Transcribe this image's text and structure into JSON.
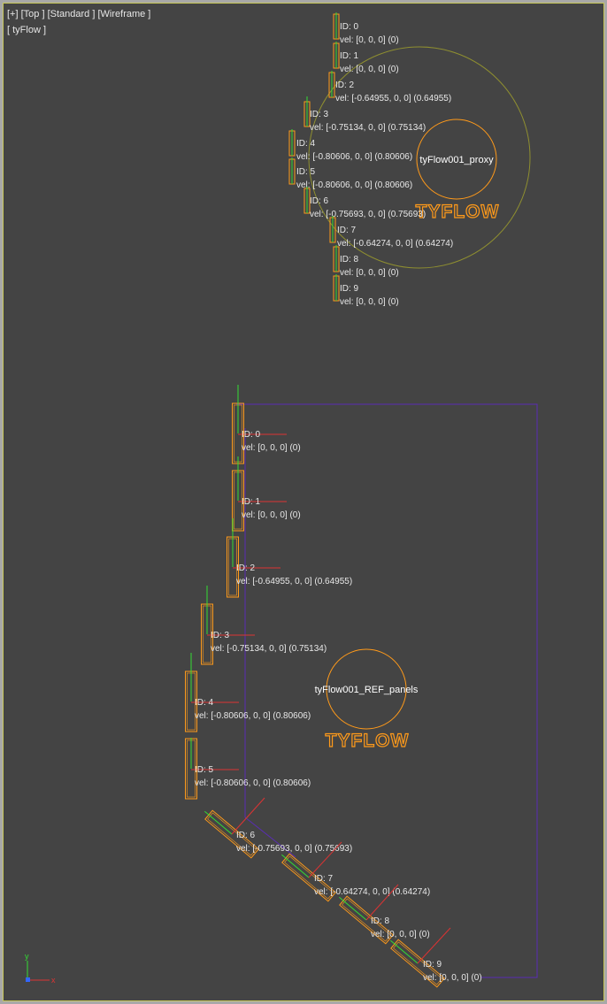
{
  "viewport": {
    "menu_plus": "[+]",
    "menu_view": "[Top ]",
    "menu_shading": "[Standard ]",
    "menu_display": "[Wireframe ]",
    "object_label": "[ tyFlow ]",
    "colors": {
      "background": "#444444",
      "border": "#c8c85a",
      "particle": "#ff9a1a",
      "y_axis": "#33dd33",
      "x_axis": "#dd3333",
      "bbox": "#5a2db5",
      "ring": "#9b9b35"
    }
  },
  "top_group": {
    "particles": [
      {
        "id": "ID: 0",
        "vel": "vel: [0, 0, 0] (0)"
      },
      {
        "id": "ID: 1",
        "vel": "vel: [0, 0, 0] (0)"
      },
      {
        "id": "ID: 2",
        "vel": "vel: [-0.64955, 0, 0] (0.64955)"
      },
      {
        "id": "ID: 3",
        "vel": "vel: [-0.75134, 0, 0] (0.75134)"
      },
      {
        "id": "ID: 4",
        "vel": "vel: [-0.80606, 0, 0] (0.80606)"
      },
      {
        "id": "ID: 5",
        "vel": "vel: [-0.80606, 0, 0] (0.80606)"
      },
      {
        "id": "ID: 6",
        "vel": "vel: [-0.75693, 0, 0] (0.75693)"
      },
      {
        "id": "ID: 7",
        "vel": "vel: [-0.64274, 0, 0] (0.64274)"
      },
      {
        "id": "ID: 8",
        "vel": "vel: [0, 0, 0] (0)"
      },
      {
        "id": "ID: 9",
        "vel": "vel: [0, 0, 0] (0)"
      }
    ],
    "proxy_name": "tyFlow001_proxy",
    "logo": "TYFLOW"
  },
  "bottom_group": {
    "particles": [
      {
        "id": "ID: 0",
        "vel": "vel: [0, 0, 0] (0)"
      },
      {
        "id": "ID: 1",
        "vel": "vel: [0, 0, 0] (0)"
      },
      {
        "id": "ID: 2",
        "vel": "vel: [-0.64955, 0, 0] (0.64955)"
      },
      {
        "id": "ID: 3",
        "vel": "vel: [-0.75134, 0, 0] (0.75134)"
      },
      {
        "id": "ID: 4",
        "vel": "vel: [-0.80606, 0, 0] (0.80606)"
      },
      {
        "id": "ID: 5",
        "vel": "vel: [-0.80606, 0, 0] (0.80606)"
      },
      {
        "id": "ID: 6",
        "vel": "vel: [-0.75693, 0, 0] (0.75693)"
      },
      {
        "id": "ID: 7",
        "vel": "vel: [-0.64274, 0, 0] (0.64274)"
      },
      {
        "id": "ID: 8",
        "vel": "vel: [0, 0, 0] (0)"
      },
      {
        "id": "ID: 9",
        "vel": "vel: [0, 0, 0] (0)"
      }
    ],
    "proxy_name": "tyFlow001_REF_panels",
    "logo": "TYFLOW"
  },
  "gizmo": {
    "y_label": "y",
    "x_label": "x"
  }
}
